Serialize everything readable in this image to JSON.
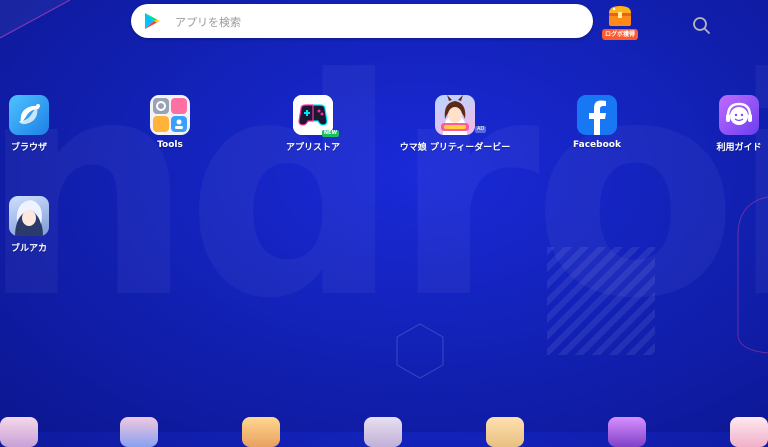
{
  "search": {
    "placeholder": "アプリを検索"
  },
  "login_bonus": {
    "label": "ログボ獲得"
  },
  "apps": [
    {
      "label": "ブラウザ"
    },
    {
      "label": "Tools"
    },
    {
      "label": "アプリストア",
      "badge": "NEW"
    },
    {
      "label": "ウマ娘 プリティーダービー",
      "badge": "AD"
    },
    {
      "label": "Facebook"
    },
    {
      "label": "利用ガイド"
    },
    {
      "label": "ブルアカ"
    }
  ],
  "background": {
    "watermark": "ndroid"
  },
  "colors": {
    "background": "#1322b8",
    "browser": "#2f9cf2",
    "facebook": "#1877f2",
    "guide": "#8a4ff0",
    "login_tag": "#ff5a2b"
  }
}
